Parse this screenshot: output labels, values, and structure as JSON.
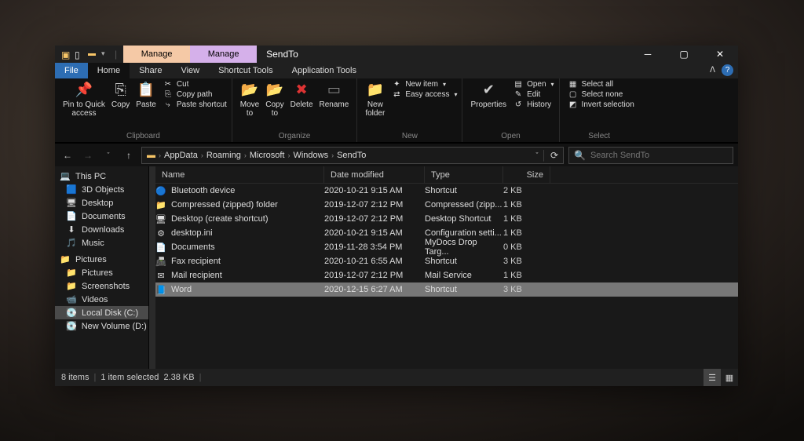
{
  "title": "SendTo",
  "context_tabs": [
    {
      "label": "Manage",
      "group": "Shortcut Tools"
    },
    {
      "label": "Manage",
      "group": "Application Tools"
    }
  ],
  "menu_tabs": [
    "File",
    "Home",
    "Share",
    "View",
    "Shortcut Tools",
    "Application Tools"
  ],
  "ribbon": {
    "clipboard": {
      "label": "Clipboard",
      "pin": "Pin to Quick\naccess",
      "copy": "Copy",
      "paste": "Paste",
      "cut": "Cut",
      "copy_path": "Copy path",
      "paste_shortcut": "Paste shortcut"
    },
    "organize": {
      "label": "Organize",
      "move": "Move\nto",
      "copy_to": "Copy\nto",
      "delete": "Delete",
      "rename": "Rename"
    },
    "new": {
      "label": "New",
      "new_folder": "New\nfolder",
      "new_item": "New item",
      "easy_access": "Easy access"
    },
    "open": {
      "label": "Open",
      "properties": "Properties",
      "open": "Open",
      "edit": "Edit",
      "history": "History"
    },
    "select": {
      "label": "Select",
      "all": "Select all",
      "none": "Select none",
      "invert": "Invert selection"
    }
  },
  "breadcrumbs": [
    "AppData",
    "Roaming",
    "Microsoft",
    "Windows",
    "SendTo"
  ],
  "search_placeholder": "Search SendTo",
  "nav": [
    {
      "icon": "💻",
      "label": "This PC",
      "hdr": true
    },
    {
      "icon": "🟦",
      "label": "3D Objects"
    },
    {
      "icon": "🖥",
      "label": "Desktop"
    },
    {
      "icon": "📄",
      "label": "Documents"
    },
    {
      "icon": "⬇",
      "label": "Downloads"
    },
    {
      "icon": "🎵",
      "label": "Music"
    },
    {
      "icon": "📁",
      "label": "Pictures",
      "hdr": true
    },
    {
      "icon": "📁",
      "label": "Pictures"
    },
    {
      "icon": "📁",
      "label": "Screenshots"
    },
    {
      "icon": "📹",
      "label": "Videos"
    },
    {
      "icon": "💽",
      "label": "Local Disk (C:)",
      "selected": true
    },
    {
      "icon": "💽",
      "label": "New Volume (D:)"
    }
  ],
  "columns": {
    "name": "Name",
    "date": "Date modified",
    "type": "Type",
    "size": "Size"
  },
  "files": [
    {
      "icon": "🔵",
      "name": "Bluetooth device",
      "date": "2020-10-21 9:15 AM",
      "type": "Shortcut",
      "size": "2 KB"
    },
    {
      "icon": "📁",
      "name": "Compressed (zipped) folder",
      "date": "2019-12-07 2:12 PM",
      "type": "Compressed (zipp...",
      "size": "1 KB"
    },
    {
      "icon": "🖥",
      "name": "Desktop (create shortcut)",
      "date": "2019-12-07 2:12 PM",
      "type": "Desktop Shortcut",
      "size": "1 KB"
    },
    {
      "icon": "⚙",
      "name": "desktop.ini",
      "date": "2020-10-21 9:15 AM",
      "type": "Configuration setti...",
      "size": "1 KB"
    },
    {
      "icon": "📄",
      "name": "Documents",
      "date": "2019-11-28 3:54 PM",
      "type": "MyDocs Drop Targ...",
      "size": "0 KB"
    },
    {
      "icon": "📠",
      "name": "Fax recipient",
      "date": "2020-10-21 6:55 AM",
      "type": "Shortcut",
      "size": "3 KB"
    },
    {
      "icon": "✉",
      "name": "Mail recipient",
      "date": "2019-12-07 2:12 PM",
      "type": "Mail Service",
      "size": "1 KB"
    },
    {
      "icon": "📘",
      "name": "Word",
      "date": "2020-12-15 6:27 AM",
      "type": "Shortcut",
      "size": "3 KB",
      "selected": true
    }
  ],
  "status": {
    "items": "8 items",
    "selected": "1 item selected",
    "size": "2.38 KB"
  }
}
